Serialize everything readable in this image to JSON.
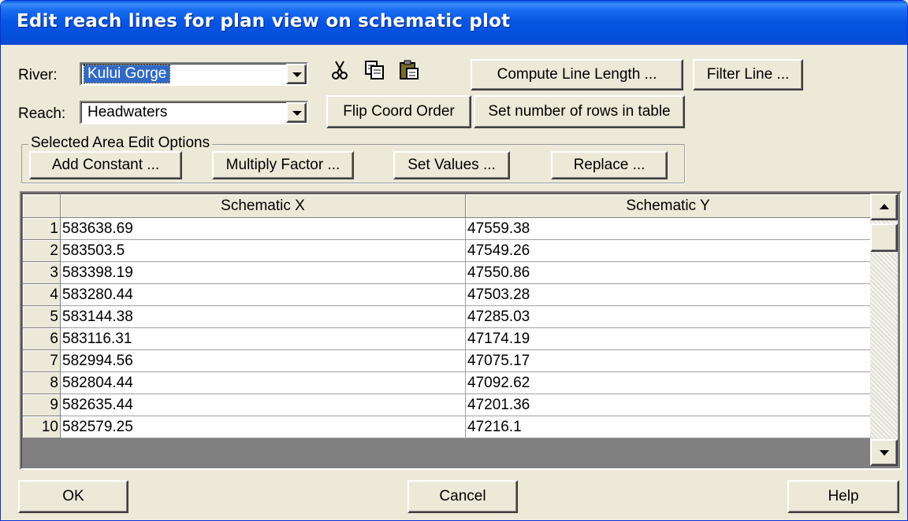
{
  "window": {
    "title": "Edit reach lines for plan view on schematic plot"
  },
  "river": {
    "label": "River:",
    "value": "Kului Gorge"
  },
  "reach": {
    "label": "Reach:",
    "value": "Headwaters"
  },
  "toolbar": {
    "cut_icon": "scissors-icon",
    "copy_icon": "copy-icon",
    "paste_icon": "paste-icon",
    "compute_line_length": "Compute Line Length ...",
    "filter_line": "Filter Line ...",
    "flip_coord_order": "Flip Coord Order",
    "set_rows": "Set number of rows in table"
  },
  "edit_options": {
    "group_label": "Selected Area Edit Options",
    "add_constant": "Add Constant ...",
    "multiply_factor": "Multiply Factor ...",
    "set_values": "Set Values ...",
    "replace": "Replace ..."
  },
  "table": {
    "columns": [
      "Schematic X",
      "Schematic Y"
    ],
    "rows": [
      {
        "n": "1",
        "x": "583638.69",
        "y": "47559.38"
      },
      {
        "n": "2",
        "x": "583503.5",
        "y": "47549.26"
      },
      {
        "n": "3",
        "x": "583398.19",
        "y": "47550.86"
      },
      {
        "n": "4",
        "x": "583280.44",
        "y": "47503.28"
      },
      {
        "n": "5",
        "x": "583144.38",
        "y": "47285.03"
      },
      {
        "n": "6",
        "x": "583116.31",
        "y": "47174.19"
      },
      {
        "n": "7",
        "x": "582994.56",
        "y": "47075.17"
      },
      {
        "n": "8",
        "x": "582804.44",
        "y": "47092.62"
      },
      {
        "n": "9",
        "x": "582635.44",
        "y": "47201.36"
      },
      {
        "n": "10",
        "x": "582579.25",
        "y": "47216.1"
      }
    ]
  },
  "footer": {
    "ok": "OK",
    "cancel": "Cancel",
    "help": "Help"
  },
  "colors": {
    "title_bar": "#0554e3",
    "dialog_bg": "#ece9d8",
    "selection": "#316ac5"
  }
}
